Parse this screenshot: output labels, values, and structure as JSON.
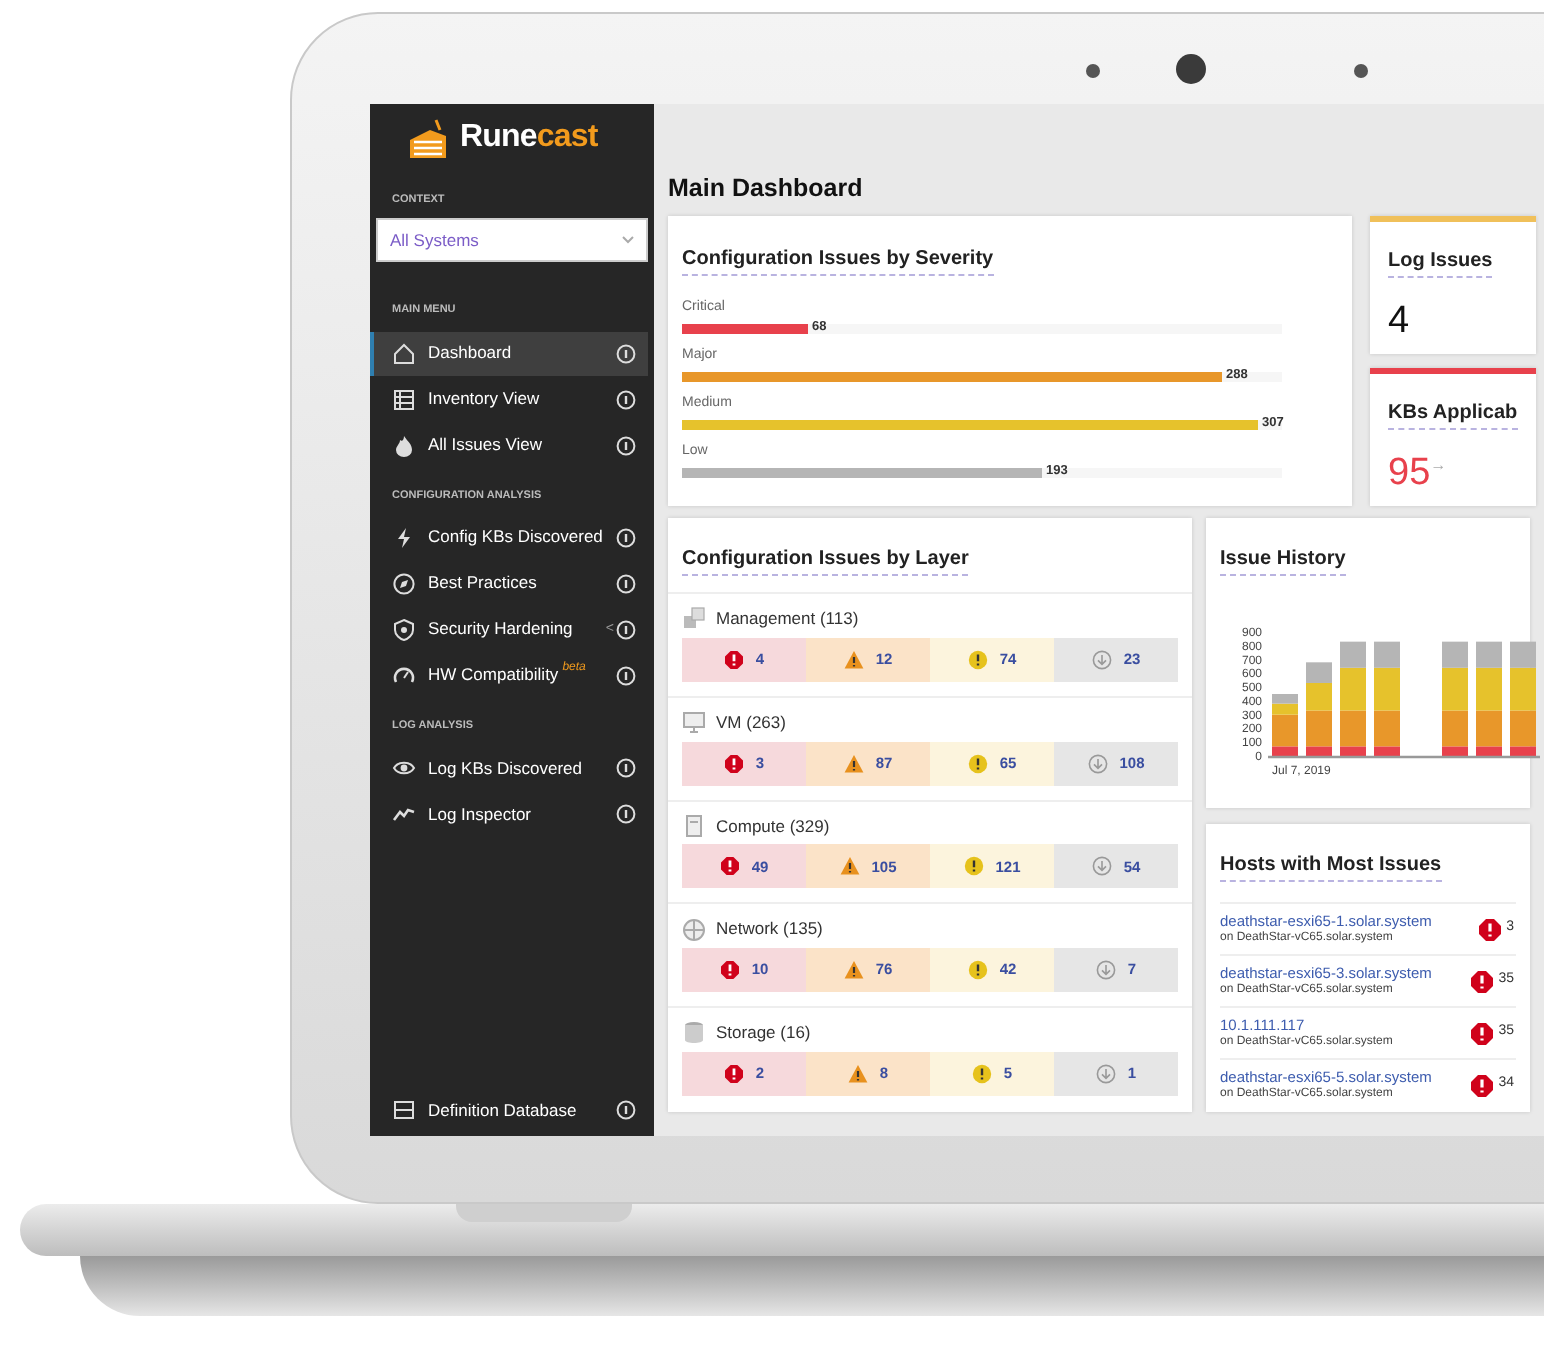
{
  "sidebar": {
    "logo": {
      "prefix": "Rune",
      "suffix": "cast"
    },
    "context": {
      "label": "CONTEXT",
      "value": "All Systems"
    },
    "sections": [
      {
        "heading": "MAIN MENU",
        "items": [
          {
            "label": "Dashboard",
            "selected": true
          },
          {
            "label": "Inventory View",
            "selected": false
          },
          {
            "label": "All Issues View",
            "selected": false
          }
        ]
      },
      {
        "heading": "CONFIGURATION ANALYSIS",
        "items": [
          {
            "label": "Config KBs Discovered",
            "selected": false
          },
          {
            "label": "Best Practices",
            "selected": false
          },
          {
            "label": "Security Hardening",
            "selected": false,
            "suffix": "<"
          },
          {
            "label": "HW Compatibility",
            "selected": false,
            "badge": "beta"
          }
        ]
      },
      {
        "heading": "LOG ANALYSIS",
        "items": [
          {
            "label": "Log KBs Discovered",
            "selected": false
          },
          {
            "label": "Log Inspector",
            "selected": false
          }
        ]
      }
    ],
    "footer_item": {
      "label": "Definition Database",
      "selected": false
    }
  },
  "page_title": "Main Dashboard",
  "severity_card": {
    "title": "Configuration Issues by Severity",
    "bars": [
      {
        "label": "Critical",
        "value": "68",
        "level": 0.21,
        "color": "#e8414c"
      },
      {
        "label": "Major",
        "value": "288",
        "level": 0.9,
        "color": "#e8972a"
      },
      {
        "label": "Medium",
        "value": "307",
        "level": 0.96,
        "color": "#e6c22c"
      },
      {
        "label": "Low",
        "value": "193",
        "level": 0.6,
        "color": "#b5b5b5"
      }
    ]
  },
  "log_issues": {
    "title": "Log Issues",
    "value": "4",
    "color": "#f0c05a"
  },
  "kbs_applicable": {
    "title": "KBs Applicab",
    "value": "95",
    "trend": "→",
    "color": "#e8414c"
  },
  "layer_card": {
    "title": "Configuration Issues by Layer",
    "layers": [
      {
        "name": "Management (113)",
        "counts": [
          "4",
          "12",
          "74",
          "23"
        ]
      },
      {
        "name": "VM (263)",
        "counts": [
          "3",
          "87",
          "65",
          "108"
        ]
      },
      {
        "name": "Compute (329)",
        "counts": [
          "49",
          "105",
          "121",
          "54"
        ]
      },
      {
        "name": "Network (135)",
        "counts": [
          "10",
          "76",
          "42",
          "7"
        ]
      },
      {
        "name": "Storage (16)",
        "counts": [
          "2",
          "8",
          "5",
          "1"
        ]
      }
    ]
  },
  "issue_history": {
    "title": "Issue History",
    "chart_data": {
      "type": "bar",
      "stacked": true,
      "xlabel": "Jul 7, 2019",
      "ylim": [
        0,
        900
      ],
      "yticks": [
        {
          "value": 0,
          "label": "0"
        },
        {
          "value": 100,
          "label": "100"
        },
        {
          "value": 200,
          "label": "200"
        },
        {
          "value": 300,
          "label": "300"
        },
        {
          "value": 400,
          "label": "400"
        },
        {
          "value": 500,
          "label": "500"
        },
        {
          "value": 600,
          "label": "600"
        },
        {
          "value": 700,
          "label": "700"
        },
        {
          "value": 800,
          "label": "800"
        },
        {
          "value": 900,
          "label": "900"
        }
      ],
      "series": [
        {
          "color": "#e8414c",
          "values": [
            70,
            70,
            70,
            70,
            null,
            70,
            70,
            70
          ]
        },
        {
          "color": "#e8972a",
          "values": [
            230,
            260,
            260,
            260,
            null,
            260,
            260,
            260
          ]
        },
        {
          "color": "#e6c22c",
          "values": [
            80,
            200,
            310,
            310,
            null,
            310,
            310,
            310
          ]
        },
        {
          "color": "#b5b5b5",
          "values": [
            70,
            150,
            190,
            190,
            null,
            190,
            190,
            190
          ]
        }
      ]
    }
  },
  "hosts_card": {
    "title": "Hosts with Most Issues",
    "hosts": [
      {
        "name": "deathstar-esxi65-1.solar.system",
        "parent": "on DeathStar-vC65.solar.system",
        "count": "3"
      },
      {
        "name": "deathstar-esxi65-3.solar.system",
        "parent": "on DeathStar-vC65.solar.system",
        "count": "35"
      },
      {
        "name": "10.1.111.117",
        "parent": "on DeathStar-vC65.solar.system",
        "count": "35"
      },
      {
        "name": "deathstar-esxi65-5.solar.system",
        "parent": "on DeathStar-vC65.solar.system",
        "count": "34"
      }
    ]
  }
}
